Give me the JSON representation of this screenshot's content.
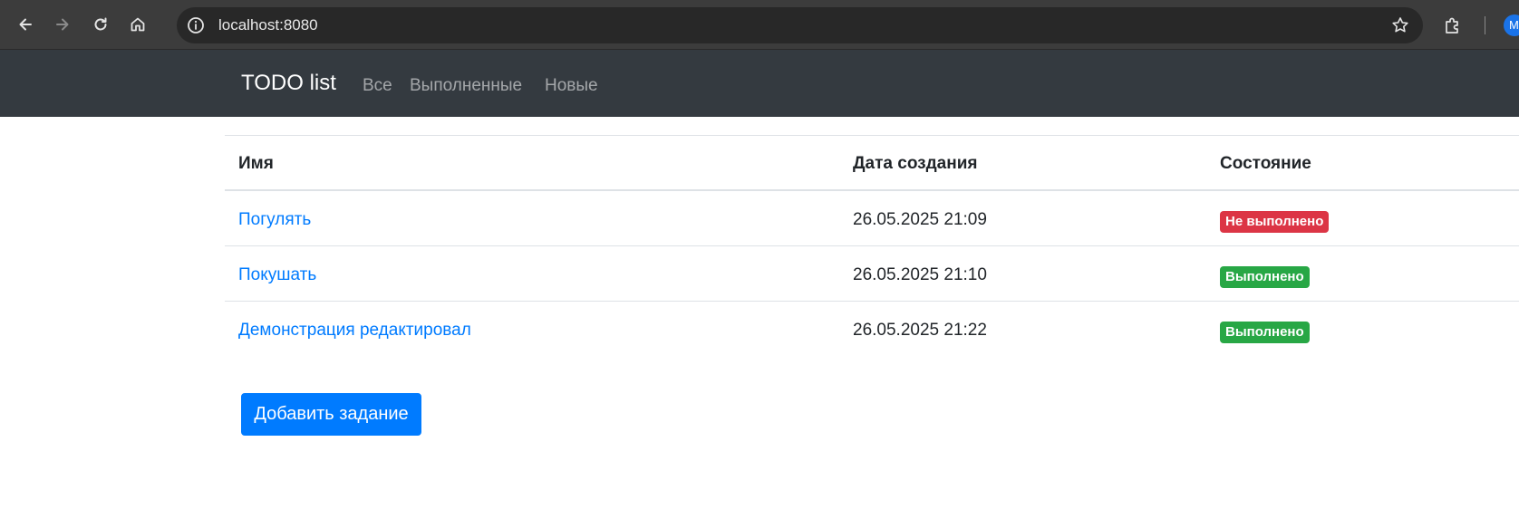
{
  "browser": {
    "url": "localhost:8080",
    "avatar_letter": "M",
    "icons": {
      "back": "back-arrow-icon",
      "forward": "forward-arrow-icon",
      "reload": "reload-icon",
      "home": "home-icon",
      "info": "info-icon",
      "bookmark": "star-icon",
      "extensions": "puzzle-icon"
    }
  },
  "navbar": {
    "brand": "TODO list",
    "links": [
      "Все",
      "Выполненные",
      "Новые"
    ]
  },
  "table": {
    "headers": [
      "Имя",
      "Дата создания",
      "Состояние"
    ],
    "rows": [
      {
        "name": "Погулять",
        "created": "26.05.2025 21:09",
        "status": "Не выполнено",
        "status_color": "#dc3545"
      },
      {
        "name": "Покушать",
        "created": "26.05.2025 21:10",
        "status": "Выполнено",
        "status_color": "#28a745"
      },
      {
        "name": "Демонстрация редактировал",
        "created": "26.05.2025 21:22",
        "status": "Выполнено",
        "status_color": "#28a745"
      }
    ]
  },
  "add_button": "Добавить задание",
  "colors": {
    "navbar_bg": "#343a40",
    "link": "#007bff",
    "primary": "#007bff",
    "danger": "#dc3545",
    "success": "#28a745"
  }
}
